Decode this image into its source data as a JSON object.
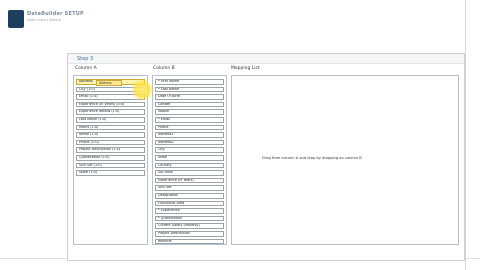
{
  "logo": {
    "title": "DataBuilder SETUP",
    "subtitle": "Data Import Wizard"
  },
  "panel": {
    "step_label": "Step 3"
  },
  "columns": {
    "column_a_label": "Column A",
    "column_b_label": "Column B",
    "mapping_label": "Mapping List"
  },
  "drag_chip_label": "Address",
  "column_a": [
    "Address",
    "City (1:0)",
    "Email (1:0)",
    "Experience (in years) (0:0)",
    "Experience details (1:0)",
    "Last Name (1:0)",
    "Marks (1:0)",
    "Name (1:0)",
    "Phone (1:0)",
    "Project Description (1:0)",
    "Qualification (1:0)",
    "Skill Set (1:0)",
    "State (1:0)"
  ],
  "column_b": [
    "* First Name",
    "* Last Name",
    "Date Of Birth",
    "Gender",
    "Mobile",
    "* Email",
    "Phone",
    "Address1",
    "Address2",
    "City",
    "State",
    "Country",
    "Zip code",
    "Experience (in Years)",
    "Skill Set",
    "Designation",
    "Functional Area",
    "* Experience",
    "* Qualification",
    "Current Salary (Monthly)",
    "Project Description",
    "Resume"
  ],
  "mapping_hint": "Drag from column A and drop by dropping on column B",
  "accent_colors": {
    "step": "#3b6fa6",
    "highlight": "#ffe98a"
  }
}
